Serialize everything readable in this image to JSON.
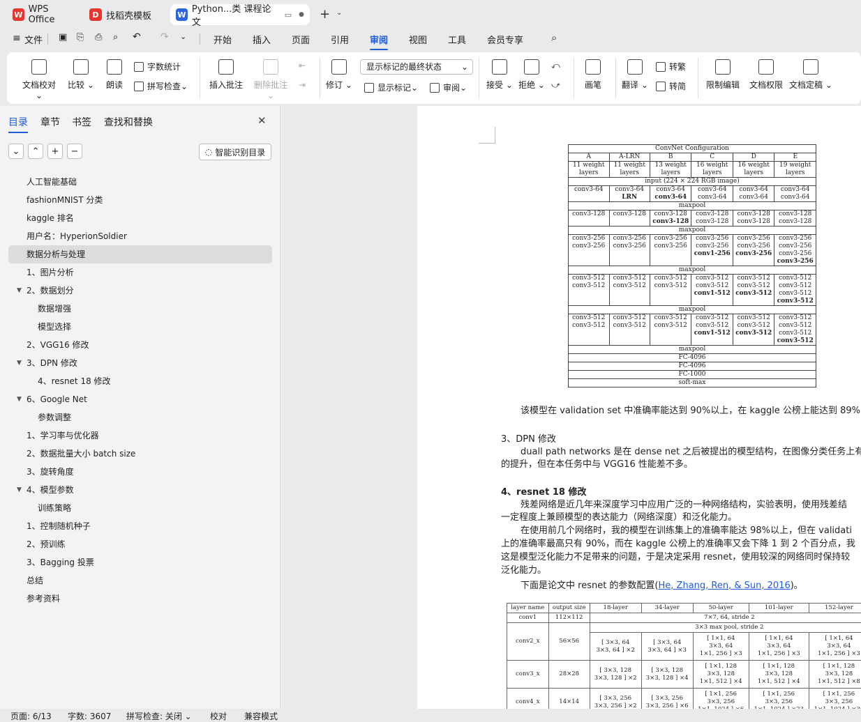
{
  "tabs": [
    {
      "label": "WPS Office",
      "logo_color": "#e8352e",
      "logo_text": "W"
    },
    {
      "label": "找稻壳模板",
      "logo_color": "#e8352e",
      "logo_text": "D"
    },
    {
      "label": "Python...类 课程论文",
      "logo_color": "#2b66e0",
      "logo_text": "W"
    }
  ],
  "menu": {
    "file": "文件",
    "items": [
      "开始",
      "插入",
      "页面",
      "引用",
      "审阅",
      "视图",
      "工具",
      "会员专享"
    ],
    "active": "审阅"
  },
  "ribbon": {
    "doc_check": "文档校对",
    "compare": "比较",
    "read_aloud": "朗读",
    "word_count": "字数统计",
    "spell_check": "拼写检查",
    "insert_comment": "插入批注",
    "delete_comment": "删除批注",
    "track": "修订",
    "display_select": "显示标记的最终状态",
    "show_marks": "显示标记",
    "review": "审阅",
    "accept": "接受",
    "reject": "拒绝",
    "pen": "画笔",
    "translate": "翻译",
    "to_trad": "转繁",
    "to_simp": "转简",
    "restrict_edit": "限制编辑",
    "doc_rights": "文档权限",
    "finalize": "文档定稿"
  },
  "panel": {
    "tabs": [
      "目录",
      "章节",
      "书签",
      "查找和替换"
    ],
    "smart_btn": "智能识别目录",
    "toc": [
      {
        "label": "人工智能基础",
        "level": 0
      },
      {
        "label": "fashionMNIST 分类",
        "level": 0
      },
      {
        "label": "kaggle 排名",
        "level": 0
      },
      {
        "label": "用户名：HyperionSoldier",
        "level": 0
      },
      {
        "label": "数据分析与处理",
        "level": 0,
        "selected": true
      },
      {
        "label": "1、图片分析",
        "level": 0
      },
      {
        "label": "2、数据划分",
        "level": 0,
        "expanded": true
      },
      {
        "label": "数据增强",
        "level": 1
      },
      {
        "label": "模型选择",
        "level": 1
      },
      {
        "label": "2、VGG16 修改",
        "level": 0
      },
      {
        "label": "3、DPN 修改",
        "level": 0,
        "expanded": true
      },
      {
        "label": "4、resnet 18 修改",
        "level": 1
      },
      {
        "label": "6、Google Net",
        "level": 0,
        "expanded": true
      },
      {
        "label": "参数调整",
        "level": 1
      },
      {
        "label": "1、学习率与优化器",
        "level": 0
      },
      {
        "label": "2、数据批量大小 batch size",
        "level": 0
      },
      {
        "label": "3、旋转角度",
        "level": 0
      },
      {
        "label": "4、模型参数",
        "level": 0,
        "expanded": true
      },
      {
        "label": "训练策略",
        "level": 1
      },
      {
        "label": "1、控制随机种子",
        "level": 0
      },
      {
        "label": "2、预训练",
        "level": 0
      },
      {
        "label": "3、Bagging 投票",
        "level": 0
      },
      {
        "label": "总结",
        "level": 0
      },
      {
        "label": "参考资料",
        "level": 0
      }
    ]
  },
  "document": {
    "cfg_title": "ConvNet Configuration",
    "cfg_cols": [
      "A",
      "A-LRN",
      "B",
      "C",
      "D",
      "E"
    ],
    "cfg_layers": [
      "11 weight layers",
      "11 weight layers",
      "13 weight layers",
      "16 weight layers",
      "16 weight layers",
      "19 weight layers"
    ],
    "cfg_input": "input (224 × 224 RGB image)",
    "maxpool": "maxpool",
    "fc1": "FC-4096",
    "fc2": "FC-4096",
    "fc3": "FC-1000",
    "softmax": "soft-max",
    "para1": "该模型在 validation set 中准确率能达到 90%以上，在 kaggle 公榜上能达到 89%,",
    "h_dpn": "3、DPN 修改",
    "para_dpn1": "duall path networks 是在 dense net 之后被提出的模型结构，在图像分类任务上有",
    "para_dpn2": "的提升，但在本任务中与 VGG16 性能差不多。",
    "h_resnet": "4、resnet 18 修改",
    "para_r1": "残差网络是近几年来深度学习中应用广泛的一种网络结构，实验表明，使用残差结",
    "para_r2": "一定程度上兼顾模型的表达能力（网络深度）和泛化能力。",
    "para_r3": "在使用前几个网络时，我的模型在训练集上的准确率能达 98%以上，但在 validati",
    "para_r4": "上的准确率最高只有 90%，而在 kaggle 公榜上的准确率又会下降 1 到 2 个百分点，我",
    "para_r5": "这是模型泛化能力不足带来的问题，于是决定采用 resnet，使用较深的网络同时保持较",
    "para_r6": "泛化能力。",
    "para_r7a": "下面是论文中 resnet 的参数配置(",
    "para_r7link": "He, Zhang, Ren, & Sun, 2016",
    "para_r7b": ")。",
    "rn_headers": [
      "layer name",
      "output size",
      "18-layer",
      "34-layer",
      "50-layer",
      "101-layer",
      "152-layer"
    ],
    "rn_conv1": "7×7, 64, stride 2",
    "rn_pool": "3×3 max pool, stride 2"
  },
  "status": {
    "page": "页面: 6/13",
    "words": "字数: 3607",
    "spell": "拼写检查: 关闭",
    "proof": "校对",
    "compat": "兼容模式"
  }
}
